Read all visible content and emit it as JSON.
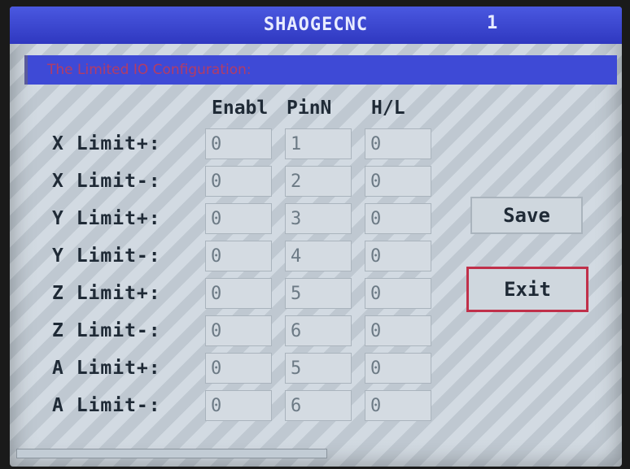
{
  "window": {
    "title": "SHAOGECNC",
    "page_number": "1"
  },
  "section_title": "The Limited IO Configuration:",
  "columns": [
    "Enabl",
    "PinN",
    "H/L"
  ],
  "rows": [
    {
      "label": "X Limit+:",
      "enable": "0",
      "pin": "1",
      "hl": "0"
    },
    {
      "label": "X Limit-:",
      "enable": "0",
      "pin": "2",
      "hl": "0"
    },
    {
      "label": "Y Limit+:",
      "enable": "0",
      "pin": "3",
      "hl": "0"
    },
    {
      "label": "Y Limit-:",
      "enable": "0",
      "pin": "4",
      "hl": "0"
    },
    {
      "label": "Z Limit+:",
      "enable": "0",
      "pin": "5",
      "hl": "0"
    },
    {
      "label": "Z Limit-:",
      "enable": "0",
      "pin": "6",
      "hl": "0"
    },
    {
      "label": "A Limit+:",
      "enable": "0",
      "pin": "5",
      "hl": "0"
    },
    {
      "label": "A Limit-:",
      "enable": "0",
      "pin": "6",
      "hl": "0"
    }
  ],
  "buttons": {
    "save": "Save",
    "exit": "Exit"
  },
  "colors": {
    "title_bar": "#3a44cc",
    "screen_bg": "#c9d3dc",
    "exit_border": "#c0304a",
    "section_text": "#c83a52"
  }
}
